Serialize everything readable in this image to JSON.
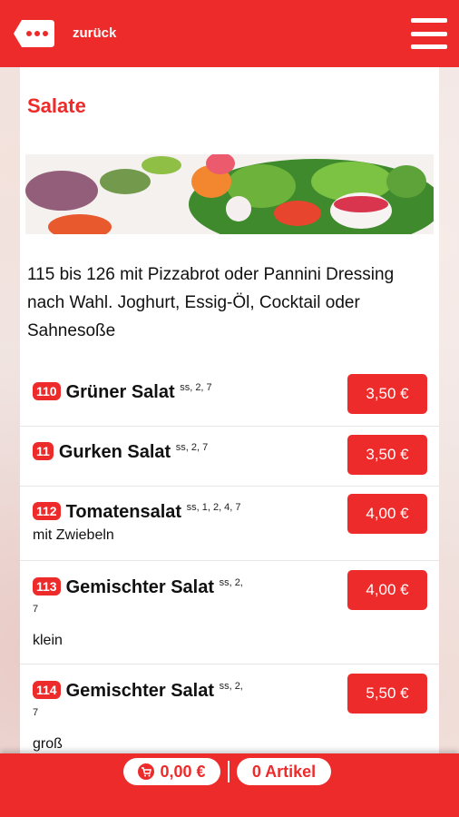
{
  "header": {
    "back_label": "zurück"
  },
  "section": {
    "title": "Salate",
    "description": "115 bis 126 mit Pizzabrot oder Pannini Dressing nach Wahl. Joghurt, Essig-Öl, Cocktail oder Sahnesoße"
  },
  "items": [
    {
      "number": "110",
      "name": "Grüner Salat",
      "allergens": "ss, 2, 7",
      "sub": "",
      "price": "3,50 €"
    },
    {
      "number": "11",
      "name": "Gurken Salat",
      "allergens": "ss, 2, 7",
      "sub": "",
      "price": "3,50 €"
    },
    {
      "number": "112",
      "name": "Tomatensalat",
      "allergens": "ss, 1, 2, 4, 7",
      "sub": "mit Zwiebeln",
      "price": "4,00 €"
    },
    {
      "number": "113",
      "name": "Gemischter Salat",
      "allergens": "ss, 2,",
      "allergens_line2": "7",
      "sub": "klein",
      "price": "4,00 €"
    },
    {
      "number": "114",
      "name": "Gemischter Salat",
      "allergens": "ss, 2,",
      "allergens_line2": "7",
      "sub": "groß",
      "price": "5,50 €"
    }
  ],
  "footer": {
    "cart_total": "0,00 €",
    "article_count": "0 Artikel"
  },
  "colors": {
    "accent": "#ee2b2b"
  },
  "icons": {
    "back": "back-bubble-icon",
    "menu": "hamburger-menu-icon",
    "cart": "cart-icon"
  }
}
